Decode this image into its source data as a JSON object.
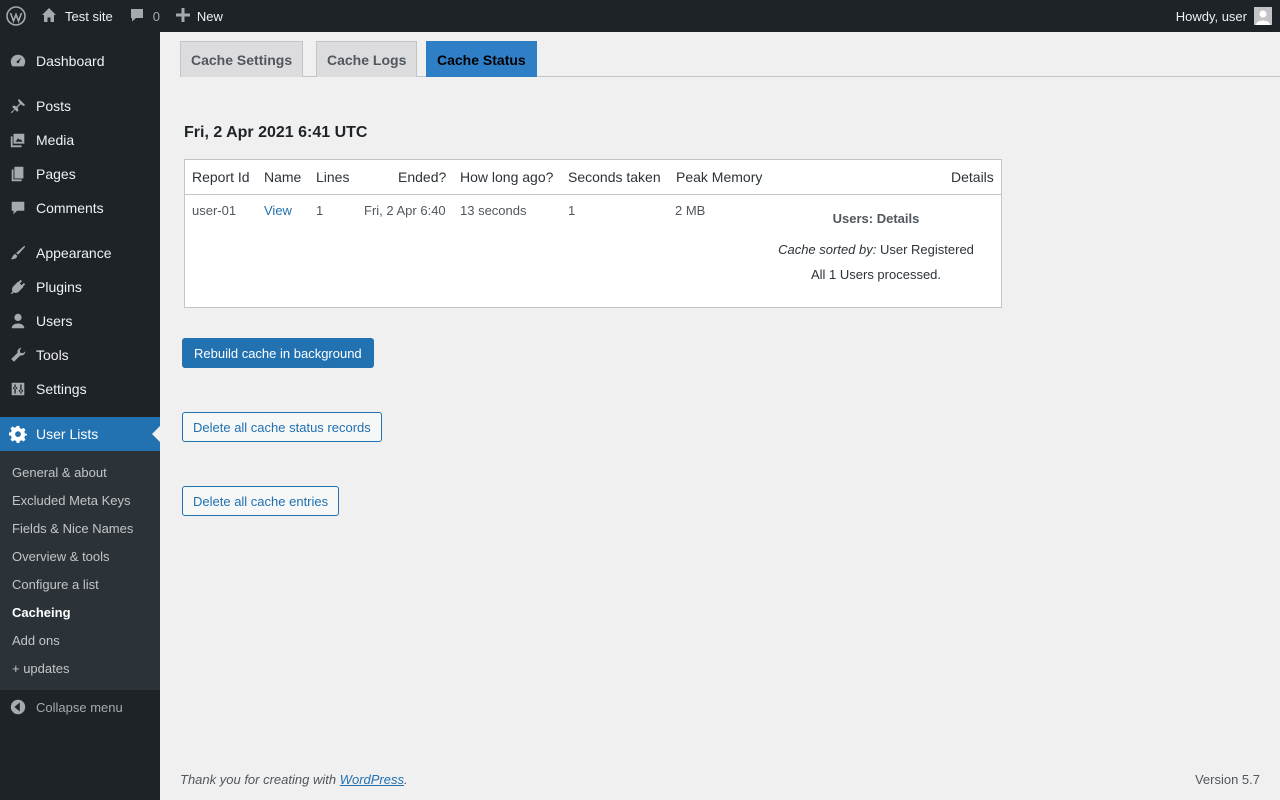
{
  "adminbar": {
    "site_name": "Test site",
    "comments_count": "0",
    "new_label": "New",
    "howdy": "Howdy, user"
  },
  "sidebar": {
    "items": [
      {
        "label": "Dashboard",
        "icon": "dashboard-icon"
      },
      {
        "label": "Posts",
        "icon": "pin-icon"
      },
      {
        "label": "Media",
        "icon": "media-icon"
      },
      {
        "label": "Pages",
        "icon": "pages-icon"
      },
      {
        "label": "Comments",
        "icon": "comment-icon"
      },
      {
        "label": "Appearance",
        "icon": "brush-icon"
      },
      {
        "label": "Plugins",
        "icon": "plug-icon"
      },
      {
        "label": "Users",
        "icon": "user-icon"
      },
      {
        "label": "Tools",
        "icon": "wrench-icon"
      },
      {
        "label": "Settings",
        "icon": "settings-sliders-icon"
      },
      {
        "label": "User Lists",
        "icon": "gear-icon"
      }
    ],
    "submenu": [
      "General & about",
      "Excluded Meta Keys",
      "Fields & Nice Names",
      "Overview & tools",
      "Configure a list",
      "Cacheing",
      "Add ons",
      "+ updates"
    ],
    "collapse_label": "Collapse menu"
  },
  "tabs": [
    "Cache Settings",
    "Cache Logs",
    "Cache Status"
  ],
  "date_heading": "Fri, 2 Apr 2021 6:41 UTC",
  "table": {
    "headers": [
      "Report Id",
      "Name",
      "Lines",
      "Ended?",
      "How long ago?",
      "Seconds taken",
      "Peak Memory",
      "Details"
    ],
    "row": {
      "report_id": "user-01",
      "name": "View",
      "lines": "1",
      "ended": "Fri, 2 Apr 6:40",
      "how_long_ago": "13 seconds",
      "seconds_taken": "1",
      "peak_memory": "2 MB",
      "details_title": "Users: Details",
      "sorted_by_label": "Cache sorted by:",
      "sorted_by_value": "User Registered",
      "processed": "All 1 Users processed."
    }
  },
  "buttons": {
    "rebuild": "Rebuild cache in background",
    "delete_status": "Delete all cache status records",
    "delete_entries": "Delete all cache entries"
  },
  "footer": {
    "thanks_prefix": "Thank you for creating with",
    "wp_link": "WordPress",
    "thanks_suffix": ".",
    "version": "Version 5.7"
  }
}
